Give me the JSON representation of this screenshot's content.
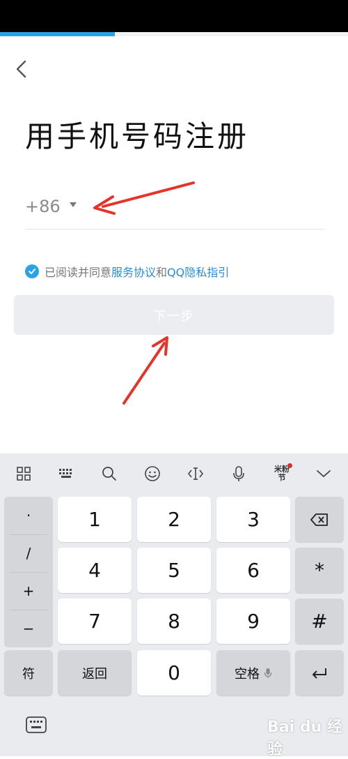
{
  "progress": {
    "fraction": 0.33
  },
  "page": {
    "title": "用手机号码注册",
    "country_code": "+86",
    "phone_placeholder": "",
    "agreement": {
      "prefix": "已阅读并同意",
      "service_link": "服务协议",
      "and": "和",
      "privacy_link": "QQ隐私指引"
    },
    "next_button": "下一步"
  },
  "keyboard": {
    "toolbar_icons": [
      "grid-icon",
      "keyboard-icon",
      "search-icon",
      "emoji-icon",
      "cursor-icon",
      "mic-icon",
      "festival-icon",
      "collapse-icon"
    ],
    "festival_label_top": "米粉",
    "festival_label_bottom": "节",
    "symbols": [
      "·",
      "/",
      "+",
      "−"
    ],
    "digits": [
      "1",
      "2",
      "3",
      "4",
      "5",
      "6",
      "7",
      "8",
      "9",
      "0"
    ],
    "side_keys": [
      "⌫",
      "*",
      "#",
      "↵"
    ],
    "bottom": {
      "symbols": "符",
      "back": "返回",
      "space": "空格"
    }
  },
  "watermark": "Bai du 经验",
  "colors": {
    "accent": "#2aa3e6",
    "link": "#2a8bd6",
    "arrow": "#e5352b"
  }
}
